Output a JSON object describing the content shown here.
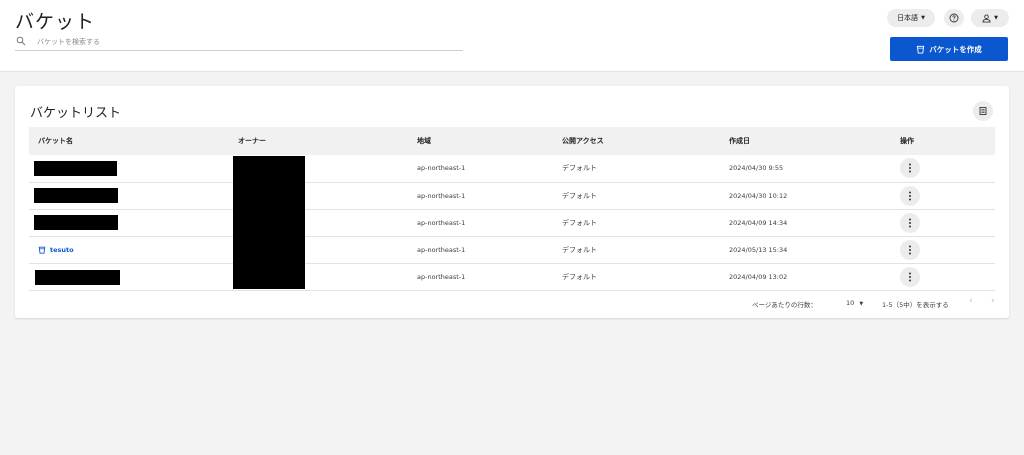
{
  "header": {
    "title": "バケット",
    "search": {
      "placeholder": "バケットを検索する",
      "value": ""
    },
    "language_label": "日本語",
    "create_button_label": "バケットを作成",
    "colors": {
      "primary": "#0b57d0",
      "background": "#f3f3f3"
    }
  },
  "bucket_list": {
    "title": "バケットリスト",
    "columns": [
      "バケット名",
      "オーナー",
      "地域",
      "公開アクセス",
      "作成日",
      "操作"
    ],
    "rows": [
      {
        "name": "",
        "name_redacted": true,
        "region": "ap-northeast-1",
        "public_access": "デフォルト",
        "created": "2024/04/30 9:55"
      },
      {
        "name": "",
        "name_redacted": true,
        "region": "ap-northeast-1",
        "public_access": "デフォルト",
        "created": "2024/04/30 10:12"
      },
      {
        "name": "",
        "name_redacted": true,
        "region": "ap-northeast-1",
        "public_access": "デフォルト",
        "created": "2024/04/09 14:34"
      },
      {
        "name": "tesuto",
        "name_redacted": false,
        "region": "ap-northeast-1",
        "public_access": "デフォルト",
        "created": "2024/05/13 15:34"
      },
      {
        "name": "",
        "name_redacted": true,
        "region": "ap-northeast-1",
        "public_access": "デフォルト",
        "created": "2024/04/09 13:02"
      }
    ],
    "owner_redacted": true
  },
  "pagination": {
    "rows_per_page_label": "ページあたりの行数：",
    "rows_per_page": "10",
    "range_text": "1-5（5中）を表示する"
  }
}
